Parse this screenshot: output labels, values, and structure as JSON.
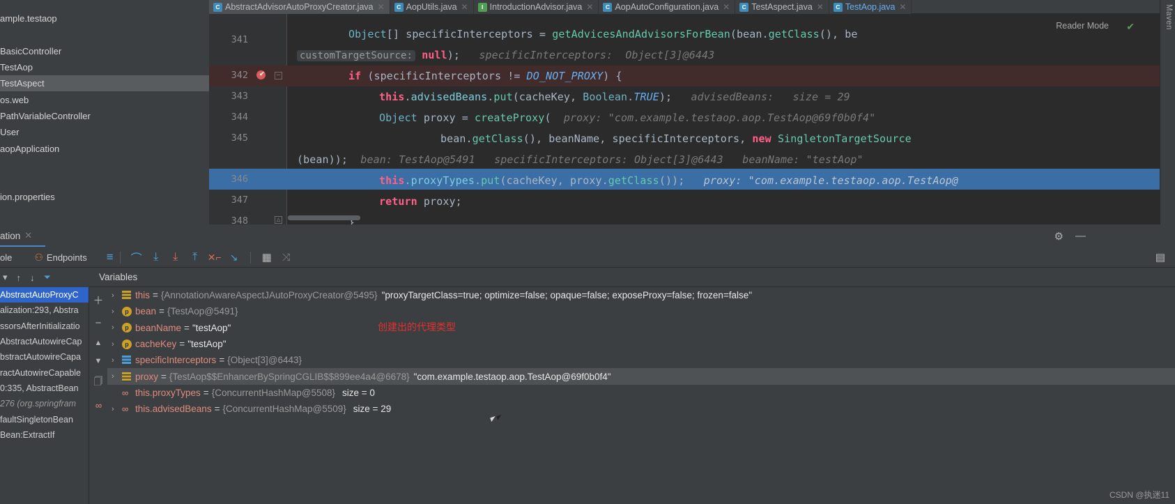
{
  "window": {
    "watermark": "CSDN @执迷11",
    "side_strip_label": "Maven"
  },
  "tabs": [
    {
      "label": "AbstractAdvisorAutoProxyCreator.java",
      "icon": "class-icon",
      "type": "class",
      "active": true,
      "modified": false
    },
    {
      "label": "AopUtils.java",
      "icon": "class-icon",
      "type": "class",
      "active": false,
      "modified": false
    },
    {
      "label": "IntroductionAdvisor.java",
      "icon": "interface-icon",
      "type": "interface",
      "active": false,
      "modified": false
    },
    {
      "label": "AopAutoConfiguration.java",
      "icon": "class-icon",
      "type": "class",
      "active": false,
      "modified": false
    },
    {
      "label": "TestAspect.java",
      "icon": "class-icon",
      "type": "class",
      "active": false,
      "modified": false
    },
    {
      "label": "TestAop.java",
      "icon": "class-icon",
      "type": "class",
      "active": false,
      "modified": true
    }
  ],
  "project_tree": {
    "items": [
      {
        "label": "ample.testaop",
        "selected": false
      },
      {
        "label": "",
        "selected": false
      },
      {
        "label": "BasicController",
        "selected": false
      },
      {
        "label": "TestAop",
        "selected": false
      },
      {
        "label": "TestAspect",
        "selected": true
      },
      {
        "label": "os.web",
        "selected": false
      },
      {
        "label": "PathVariableController",
        "selected": false
      },
      {
        "label": "User",
        "selected": false
      },
      {
        "label": "aopApplication",
        "selected": false
      },
      {
        "label": "",
        "selected": false
      },
      {
        "label": "",
        "selected": false
      },
      {
        "label": "ion.properties",
        "selected": false
      }
    ]
  },
  "editor": {
    "reader_mode_label": "Reader Mode",
    "inspection_ok_icon": "checkmark-icon",
    "lines": [
      {
        "number": "341",
        "breakpoint": false
      },
      {
        "number": "342",
        "breakpoint": true,
        "fold": true
      },
      {
        "number": "343",
        "breakpoint": false
      },
      {
        "number": "344",
        "breakpoint": false
      },
      {
        "number": "345",
        "breakpoint": false
      },
      {
        "number": "346",
        "breakpoint": false,
        "current": true
      },
      {
        "number": "347",
        "breakpoint": false
      },
      {
        "number": "348",
        "breakpoint": false,
        "fold": true
      }
    ],
    "code": {
      "l341_a": "Object[] specificInterceptors = getAdvicesAndAdvisorsForBean(bean.getClass(), be",
      "l341_b_label": "customTargetSource:",
      "l341_b_value": "null",
      "l341_b_rest": ");",
      "l341_b_hint": "specificInterceptors:  Object[3]@6443",
      "l342": "if (specificInterceptors != DO_NOT_PROXY) {",
      "l342_const": "DO_NOT_PROXY",
      "l343": "this.advisedBeans.put(cacheKey, Boolean.TRUE);",
      "l343_hint": "advisedBeans:   size = 29",
      "l344": "Object proxy = createProxy(",
      "l344_hint": "proxy: \"com.example.testaop.aop.TestAop@69f0b0f4\"",
      "l345": "bean.getClass(), beanName, specificInterceptors, new SingletonTargetSource",
      "l345b": "(bean));",
      "l345b_hint1": "bean: TestAop@5491",
      "l345b_hint2": "specificInterceptors: Object[3]@6443",
      "l345b_hint3": "beanName: \"testAop\"",
      "l346": "this.proxyTypes.put(cacheKey, proxy.getClass());",
      "l346_hint": "proxy: \"com.example.testaop.aop.TestAop@",
      "l347": "return proxy;",
      "l348": "}"
    }
  },
  "debug_panel": {
    "tab_label": "ation",
    "tab_close_icon": "close-icon",
    "settings_icon": "gear-icon",
    "minimize_icon": "minimize-icon",
    "layout_icon": "layout-icon",
    "toolbar": {
      "console_label": "ole",
      "endpoints_label": "Endpoints",
      "buttons": [
        {
          "name": "show-execution-point-icon",
          "glyph": "≡",
          "color": "#4a9fd8"
        },
        {
          "name": "step-over-icon",
          "glyph": "⌒",
          "color": "#4a9fd8"
        },
        {
          "name": "step-into-icon",
          "glyph": "↓",
          "color": "#4a9fd8"
        },
        {
          "name": "force-step-into-icon",
          "glyph": "↓",
          "color": "#d96a5a"
        },
        {
          "name": "step-out-icon",
          "glyph": "↑",
          "color": "#4a9fd8"
        },
        {
          "name": "drop-frame-icon",
          "glyph": "✕",
          "color": "#d96a5a"
        },
        {
          "name": "run-to-cursor-icon",
          "glyph": "↘",
          "color": "#4a9fd8"
        },
        {
          "name": "evaluate-expression-icon",
          "glyph": "▤",
          "color": "#b8b8b8"
        },
        {
          "name": "settings-threads-icon",
          "glyph": "≢",
          "color": "#8a8a8a"
        }
      ]
    },
    "frames": {
      "toolbar_icons": [
        "dropdown-icon",
        "up-arrow-icon",
        "down-arrow-icon",
        "filter-icon"
      ],
      "rows": [
        {
          "label": "AbstractAutoProxyC",
          "selected": true,
          "italic": ""
        },
        {
          "label": "alization:293, Abstra",
          "selected": false,
          "italic": ""
        },
        {
          "label": "ssorsAfterInitializatio",
          "selected": false,
          "italic": ""
        },
        {
          "label": "AbstractAutowireCap",
          "selected": false,
          "italic": ""
        },
        {
          "label": "bstractAutowireCapa",
          "selected": false,
          "italic": ""
        },
        {
          "label": "ractAutowireCapable",
          "selected": false,
          "italic": ""
        },
        {
          "label": "0:335, AbstractBean",
          "selected": false,
          "italic": ""
        },
        {
          "label": "276 (org.springfram",
          "selected": false,
          "italic": "276 (org.springfram"
        },
        {
          "label": "faultSingletonBean",
          "selected": false,
          "italic": ""
        },
        {
          "label": "Bean:ExtractIf",
          "selected": false,
          "italic": ""
        }
      ]
    },
    "variables": {
      "header": "Variables",
      "side_icons": [
        "add-icon",
        "remove-icon",
        "up-icon",
        "down-icon",
        "copy-icon",
        "watch-icon"
      ],
      "annotation": "创建出的代理类型",
      "rows": [
        {
          "name": "this",
          "icon": "stack-frame-icon",
          "expandable": true,
          "selected": false,
          "value": "{AnnotationAwareAspectJAutoProxyCreator@5495}",
          "string": "\"proxyTargetClass=true; optimize=false; opaque=false; exposeProxy=false; frozen=false\"",
          "size": ""
        },
        {
          "name": "bean",
          "icon": "parameter-icon",
          "expandable": true,
          "selected": false,
          "value": "{TestAop@5491}",
          "string": "",
          "size": ""
        },
        {
          "name": "beanName",
          "icon": "parameter-icon",
          "expandable": true,
          "selected": false,
          "value": "",
          "string": "\"testAop\"",
          "size": ""
        },
        {
          "name": "cacheKey",
          "icon": "parameter-icon",
          "expandable": true,
          "selected": false,
          "value": "",
          "string": "\"testAop\"",
          "size": ""
        },
        {
          "name": "specificInterceptors",
          "icon": "array-icon",
          "expandable": true,
          "selected": false,
          "value": "{Object[3]@6443}",
          "string": "",
          "size": ""
        },
        {
          "name": "proxy",
          "icon": "stack-frame-icon",
          "expandable": true,
          "selected": true,
          "value": "{TestAop$$EnhancerBySpringCGLIB$$899ee4a4@6678}",
          "string": "\"com.example.testaop.aop.TestAop@69f0b0f4\"",
          "size": ""
        },
        {
          "name": "this.proxyTypes",
          "icon": "watch-icon",
          "expandable": false,
          "selected": false,
          "value": "{ConcurrentHashMap@5508}",
          "string": "",
          "size": "size = 0"
        },
        {
          "name": "this.advisedBeans",
          "icon": "watch-icon",
          "expandable": true,
          "selected": false,
          "value": "{ConcurrentHashMap@5509}",
          "string": "",
          "size": "size = 29"
        }
      ]
    }
  }
}
